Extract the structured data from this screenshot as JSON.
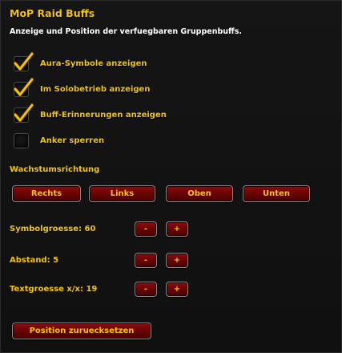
{
  "panel": {
    "title": "MoP Raid Buffs",
    "subtitle": "Anzeige und Position der verfuegbaren Gruppenbuffs."
  },
  "checkboxes": [
    {
      "label": "Aura-Symbole anzeigen",
      "checked": true
    },
    {
      "label": "Im Solobetrieb anzeigen",
      "checked": true
    },
    {
      "label": "Buff-Erinnerungen anzeigen",
      "checked": true
    },
    {
      "label": "Anker sperren",
      "checked": false
    }
  ],
  "growth": {
    "label": "Wachstumsrichtung",
    "buttons": [
      "Rechts",
      "Links",
      "Oben",
      "Unten"
    ]
  },
  "settings": [
    {
      "label": "Symbolgroesse: 60",
      "minus": "-",
      "plus": "+"
    },
    {
      "label": "Abstand: 5",
      "minus": "-",
      "plus": "+"
    },
    {
      "label": "Textgroesse x/x: 19",
      "minus": "-",
      "plus": "+"
    }
  ],
  "reset_button": "Position zuruecksetzen",
  "colors": {
    "accent": "#f2c312",
    "button_red": "#6d0404",
    "background": "#121212"
  },
  "icons": {
    "checkmark": "checkmark-icon"
  }
}
